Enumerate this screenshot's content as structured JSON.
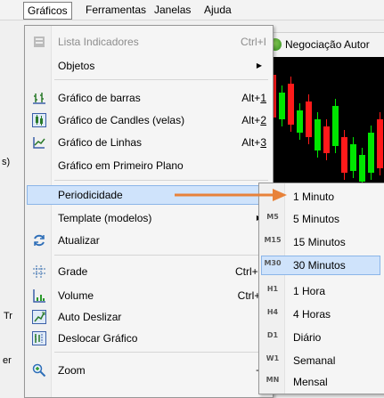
{
  "menubar": {
    "items": [
      {
        "label": "Gráficos",
        "active": true
      },
      {
        "label": "Ferramentas"
      },
      {
        "label": "Janelas"
      },
      {
        "label": "Ajuda"
      }
    ]
  },
  "toolbar": {
    "trade_label": "Negociação Autor"
  },
  "background_text": {
    "frag1": "s)",
    "frag2": "Tr",
    "frag3": "er"
  },
  "main_menu": {
    "items": [
      {
        "label": "Lista Indicadores",
        "shortcut": "Ctrl+I",
        "icon": "indicator-list-icon",
        "disabled": true
      },
      {
        "label": "Objetos",
        "submenu": true
      },
      {
        "label": "Gráfico de barras",
        "shortcut_pre": "Alt+",
        "shortcut_u": "1",
        "icon": "bar-chart-icon"
      },
      {
        "label": "Gráfico de Candles (velas)",
        "shortcut_pre": "Alt+",
        "shortcut_u": "2",
        "icon": "candle-chart-icon"
      },
      {
        "label": "Gráfico de Linhas",
        "shortcut_pre": "Alt+",
        "shortcut_u": "3",
        "icon": "line-chart-icon"
      },
      {
        "label": "Gráfico em Primeiro Plano"
      },
      {
        "label": "Periodicidade",
        "submenu": true,
        "highlighted": true
      },
      {
        "label": "Template (modelos)",
        "submenu": true
      },
      {
        "label": "Atualizar",
        "icon": "refresh-icon"
      },
      {
        "label": "Grade",
        "shortcut": "Ctrl+G",
        "icon": "grid-icon"
      },
      {
        "label": "Volume",
        "shortcut": "Ctrl+L",
        "icon": "volume-icon"
      },
      {
        "label": "Auto Deslizar",
        "icon": "auto-scroll-icon"
      },
      {
        "label": "Deslocar Gráfico",
        "icon": "chart-shift-icon"
      },
      {
        "label": "Zoom",
        "submenu_plus": "+",
        "icon": "zoom-icon"
      }
    ]
  },
  "periodicity_menu": {
    "items": [
      {
        "code": "",
        "label": "1 Minuto"
      },
      {
        "code": "M5",
        "label": "5 Minutos"
      },
      {
        "code": "M15",
        "label": "15 Minutos"
      },
      {
        "code": "M30",
        "label": "30 Minutos",
        "highlighted": true
      },
      {
        "code": "H1",
        "label": "1 Hora"
      },
      {
        "code": "H4",
        "label": "4 Horas"
      },
      {
        "code": "D1",
        "label": "Diário"
      },
      {
        "code": "W1",
        "label": "Semanal"
      },
      {
        "code": "MN",
        "label": "Mensal"
      }
    ]
  },
  "colors": {
    "highlight_bg": "#cfe3fb",
    "highlight_border": "#8bb5e8",
    "arrow": "#e8823a",
    "candle_up": "#00e600",
    "candle_down": "#ff1a1a"
  }
}
